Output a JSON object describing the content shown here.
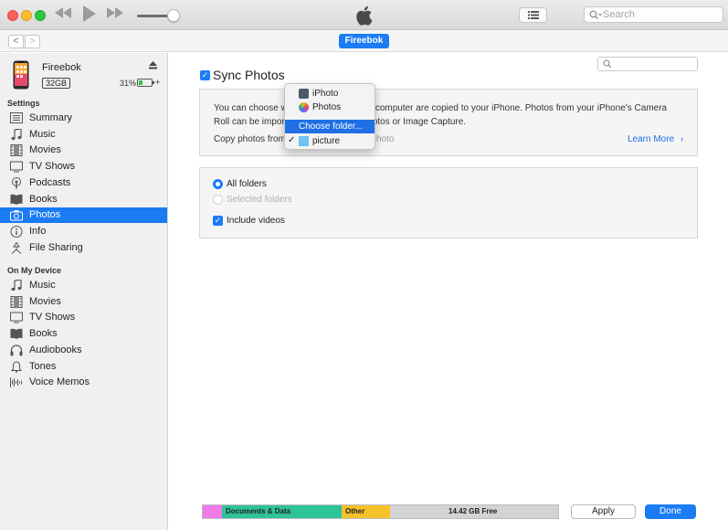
{
  "window": {
    "search_placeholder": "Search",
    "device_pill": "Fireebok"
  },
  "nav": {
    "back": "<",
    "forward": ">"
  },
  "device": {
    "name": "Fireebok",
    "capacity": "32GB",
    "battery": "31%",
    "battery_level": 0.31,
    "charging_glyph": "+"
  },
  "sidebar": {
    "settings_header": "Settings",
    "settings_items": [
      {
        "label": "Summary",
        "icon": "summary-icon"
      },
      {
        "label": "Music",
        "icon": "music-note-icon"
      },
      {
        "label": "Movies",
        "icon": "film-icon"
      },
      {
        "label": "TV Shows",
        "icon": "tv-icon"
      },
      {
        "label": "Podcasts",
        "icon": "podcast-icon"
      },
      {
        "label": "Books",
        "icon": "book-icon"
      },
      {
        "label": "Photos",
        "icon": "camera-icon",
        "active": true
      },
      {
        "label": "Info",
        "icon": "info-icon"
      },
      {
        "label": "File Sharing",
        "icon": "file-sharing-icon"
      }
    ],
    "device_header": "On My Device",
    "device_items": [
      {
        "label": "Music",
        "icon": "music-note-icon"
      },
      {
        "label": "Movies",
        "icon": "film-icon"
      },
      {
        "label": "TV Shows",
        "icon": "tv-icon"
      },
      {
        "label": "Books",
        "icon": "book-icon"
      },
      {
        "label": "Audiobooks",
        "icon": "headphones-icon"
      },
      {
        "label": "Tones",
        "icon": "bell-icon"
      },
      {
        "label": "Voice Memos",
        "icon": "voice-memo-icon"
      }
    ]
  },
  "main": {
    "sync_title": "Sync Photos",
    "description": "You can choose w                              computer are copied to your iPhone. Photos from your iPhone's Camera Roll can be impor                             otos or Image Capture.",
    "desc_line1_left": "You can choose w",
    "desc_line1_right": "computer are copied to your iPhone. Photos from your iPhone's Camera",
    "desc_line2_left": "Roll can be impor",
    "desc_line2_right": "otos or Image Capture.",
    "copy_from_label": "Copy photos from",
    "copy_from_hidden": "hoto",
    "learn_more": "Learn More",
    "all_folders": "All folders",
    "selected_folders": "Selected folders",
    "include_videos": "Include videos"
  },
  "popup_menu": {
    "items": [
      "iPhoto",
      "Photos",
      "Choose folder...",
      "picture"
    ]
  },
  "storage": {
    "segments": [
      {
        "label": "",
        "color": "#f07be6"
      },
      {
        "label": "Documents & Data",
        "color": "#2fc39a"
      },
      {
        "label": "Other",
        "color": "#f7c12a"
      },
      {
        "label": "14.42 GB Free",
        "color": "#d3d3d3"
      }
    ]
  },
  "buttons": {
    "apply": "Apply",
    "done": "Done"
  },
  "colors": {
    "accent": "#1c7cf4",
    "sidebar_bg": "#f0f0f0",
    "panel_bg": "#f5f5f5"
  }
}
